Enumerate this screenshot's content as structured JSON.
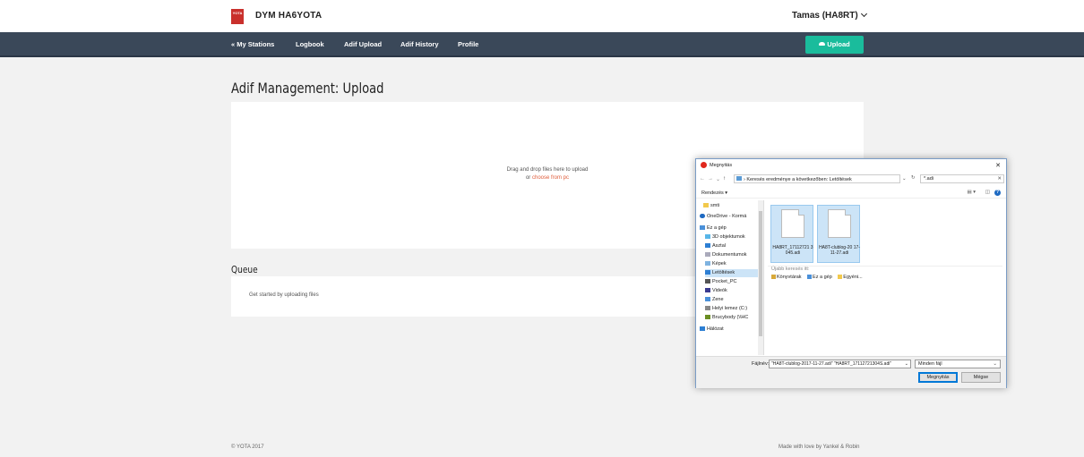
{
  "header": {
    "logo_text": "YOTA",
    "brand": "DYM HA6YOTA",
    "user": "Tamas (HA8RT)"
  },
  "nav": {
    "items": [
      "« My Stations",
      "Logbook",
      "Adif Upload",
      "Adif History",
      "Profile"
    ],
    "upload_button": "Upload"
  },
  "main": {
    "title": "Adif Management: Upload",
    "dropzone_line1": "Drag and drop files here to upload",
    "dropzone_or": "or",
    "dropzone_link": "choose from pc",
    "queue_title": "Queue",
    "queue_empty": "Get started by uploading files"
  },
  "footer": {
    "left": "© YOTA 2017",
    "right": "Made with love by Yankel & Robin"
  },
  "dialog": {
    "title": "Megnyitás",
    "address": "Keresés eredménye a következőben: Letöltések",
    "search_value": "*.adi",
    "organize": "Rendezés ▾",
    "sidebar": [
      "smti",
      "OneDrive - Kormá",
      "Ez a gép",
      "3D objektumok",
      "Asztal",
      "Dokumentumok",
      "Képek",
      "Letöltések",
      "Pocket_PC",
      "Videók",
      "Zene",
      "Helyi lemez (C:)",
      "Brucybody (\\\\HC",
      "Hálózat"
    ],
    "files": [
      {
        "name": "HA8RT_17112721 3045.adi"
      },
      {
        "name": "HA8T-clublog-20 17-11-27.adi"
      }
    ],
    "quick_label": "Újabb keresés itt:",
    "quick_items": [
      "Könyvtárak",
      "Ez a gép",
      "Egyéni..."
    ],
    "filename_label": "Fájlnév:",
    "filename_value": "\"HA8T-clublog-2017-11-27.adi\" \"HA8RT_17112721304S.adi\"",
    "filetype": "Minden fájl",
    "open_button": "Megnyitás",
    "cancel_button": "Mégse"
  }
}
